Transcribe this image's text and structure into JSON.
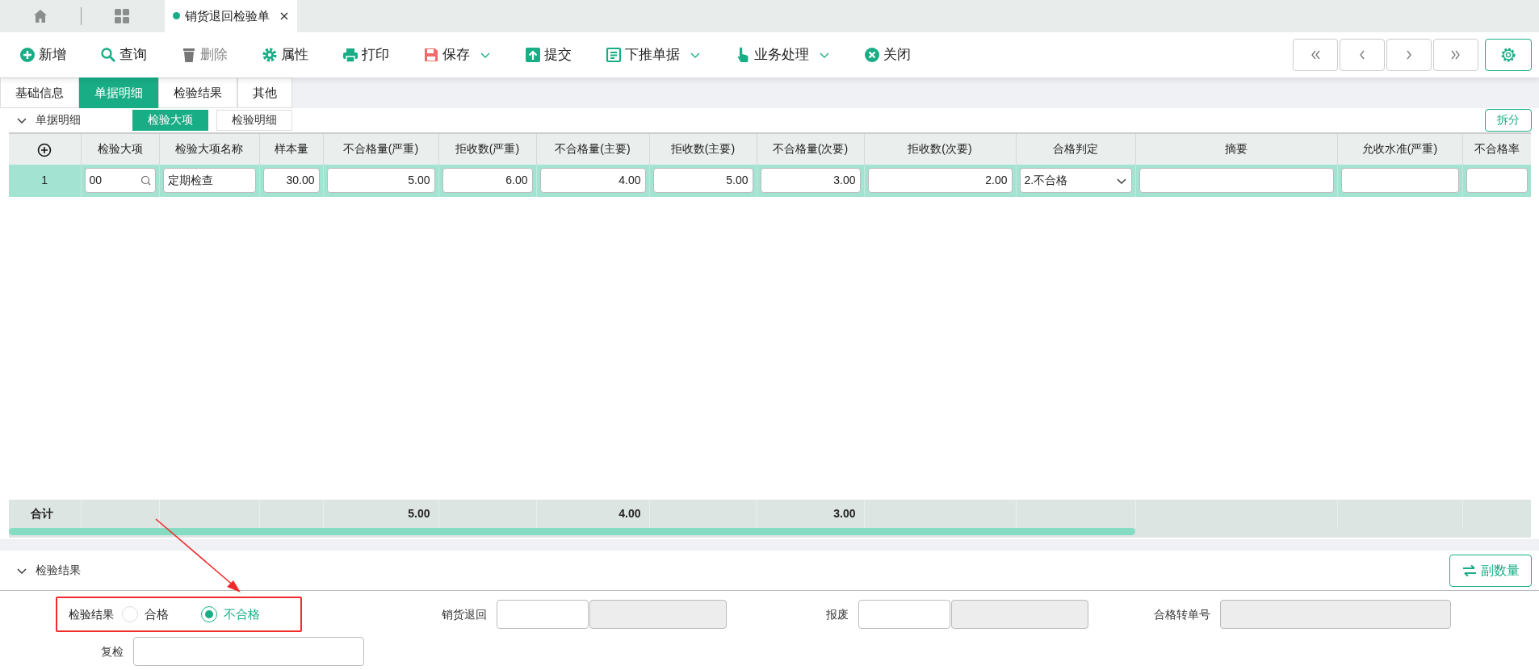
{
  "top_tabs": [
    {
      "kind": "home",
      "selected": false
    },
    {
      "kind": "apps",
      "selected": false
    },
    {
      "kind": "page",
      "label": "销货退回检验单",
      "selected": true
    }
  ],
  "toolbar": [
    {
      "kind": "add",
      "label": "新增",
      "disabled": false,
      "dropdown": false
    },
    {
      "kind": "search",
      "label": "查询",
      "disabled": false,
      "dropdown": false
    },
    {
      "kind": "delete",
      "label": "删除",
      "disabled": true,
      "dropdown": false
    },
    {
      "kind": "settings",
      "label": "属性",
      "disabled": false,
      "dropdown": false
    },
    {
      "kind": "print",
      "label": "打印",
      "disabled": false,
      "dropdown": false
    },
    {
      "kind": "save",
      "label": "保存",
      "disabled": false,
      "dropdown": true
    },
    {
      "kind": "submit",
      "label": "提交",
      "disabled": false,
      "dropdown": false
    },
    {
      "kind": "push",
      "label": "下推单据",
      "disabled": false,
      "dropdown": true
    },
    {
      "kind": "hand",
      "label": "业务处理",
      "disabled": false,
      "dropdown": true
    },
    {
      "kind": "close",
      "label": "关闭",
      "disabled": false,
      "dropdown": false
    }
  ],
  "form_tabs": [
    {
      "label": "基础信息",
      "selected": false
    },
    {
      "label": "单据明细",
      "selected": true
    },
    {
      "label": "检验结果",
      "selected": false
    },
    {
      "label": "其他",
      "selected": false
    }
  ],
  "detail_section": {
    "title": "单据明细",
    "expanded": true,
    "sub_tabs": [
      {
        "label": "检验大项",
        "selected": true
      },
      {
        "label": "检验明细",
        "selected": false
      }
    ],
    "action": "拆分"
  },
  "table": {
    "columns": [
      {
        "kind": "index"
      },
      {
        "kind": "data",
        "label": "检验大项"
      },
      {
        "kind": "data",
        "label": "检验大项名称"
      },
      {
        "kind": "data",
        "label": "样本量"
      },
      {
        "kind": "data",
        "label": "不合格量(严重)",
        "total": "5.00"
      },
      {
        "kind": "data",
        "label": "拒收数(严重)"
      },
      {
        "kind": "data",
        "label": "不合格量(主要)",
        "total": "4.00"
      },
      {
        "kind": "data",
        "label": "拒收数(主要)"
      },
      {
        "kind": "data",
        "label": "不合格量(次要)",
        "total": "3.00"
      },
      {
        "kind": "data",
        "label": "拒收数(次要)"
      },
      {
        "kind": "data",
        "label": "合格判定"
      },
      {
        "kind": "data",
        "label": "摘要"
      },
      {
        "kind": "data",
        "label": "允收水准(严重)"
      },
      {
        "kind": "data",
        "label": "不合格率"
      }
    ],
    "rows": [
      {
        "selected": true,
        "cells": [
          {
            "kind": "index",
            "value": "1"
          },
          {
            "kind": "lookup",
            "value": "00"
          },
          {
            "kind": "text",
            "value": "定期检查"
          },
          {
            "kind": "number",
            "value": "30.00"
          },
          {
            "kind": "number",
            "value": "5.00"
          },
          {
            "kind": "number",
            "value": "6.00"
          },
          {
            "kind": "number",
            "value": "4.00"
          },
          {
            "kind": "number",
            "value": "5.00"
          },
          {
            "kind": "number",
            "value": "3.00"
          },
          {
            "kind": "number",
            "value": "2.00"
          },
          {
            "kind": "select",
            "value": "2.不合格"
          },
          {
            "kind": "text"
          },
          {
            "kind": "text"
          },
          {
            "kind": "text"
          }
        ]
      }
    ],
    "totals_label": "合计"
  },
  "results_section": {
    "title": "检验结果",
    "expanded": true,
    "action": "副数量",
    "rows": [
      [
        {
          "kind": "radio",
          "label": "检验结果",
          "highlighted": true,
          "options": [
            {
              "label": "合格",
              "selected": false
            },
            {
              "label": "不合格",
              "selected": true
            }
          ]
        },
        {
          "kind": "inputs",
          "label": "销货退回",
          "inputs": [
            {
              "disabled": false
            },
            {
              "disabled": true
            }
          ]
        },
        {
          "kind": "inputs",
          "label": "报废",
          "inputs": [
            {
              "disabled": false
            },
            {
              "disabled": true
            }
          ]
        },
        {
          "kind": "inputs",
          "label": "合格转单号",
          "inputs": [
            {
              "disabled": true
            }
          ]
        }
      ],
      [
        {
          "kind": "inputs",
          "label": "复检",
          "inputs": [
            {
              "disabled": false
            }
          ]
        }
      ]
    ]
  }
}
